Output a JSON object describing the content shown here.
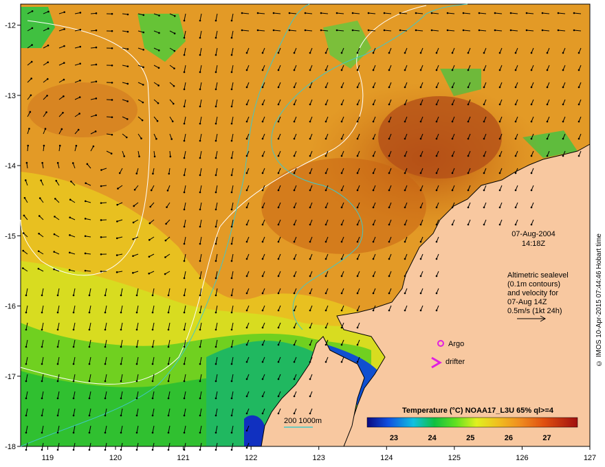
{
  "map": {
    "lon_range": [
      118.6,
      127.0
    ],
    "lat_range": [
      -18.0,
      -11.7
    ],
    "x_ticks": [
      "119",
      "120",
      "121",
      "122",
      "123",
      "124",
      "125",
      "126",
      "127"
    ],
    "y_ticks": [
      "-12",
      "-13",
      "-14",
      "-15",
      "-16",
      "-17",
      "-18"
    ]
  },
  "annotation": {
    "date": "07-Aug-2004",
    "time": "14:18Z",
    "legend_lines": [
      "Altimetric sealevel",
      "(0.1m contours)",
      "and velocity for",
      "07-Aug 14Z",
      "0.5m/s (1kt 24h)"
    ]
  },
  "markers": {
    "argo_label": "Argo",
    "drifter_label": "drifter",
    "argo_color": "#e020e0"
  },
  "bathymetry": {
    "label": "200  1000m",
    "color": "#40c8c8"
  },
  "colorbar": {
    "title": "Temperature (°C) NOAA17_L3U 65% ql>=4",
    "ticks": [
      "23",
      "24",
      "25",
      "26",
      "27"
    ],
    "min": 22.3,
    "max": 27.8
  },
  "credit": "© IMOS 10-Apr-2015 07:44:46 Hobart time",
  "colors": {
    "land": "#f8c8a0",
    "warm": "#c85a10",
    "mid": "#e8a020",
    "cool": "#d8e020",
    "green": "#40c040",
    "blue": "#2040c0"
  }
}
